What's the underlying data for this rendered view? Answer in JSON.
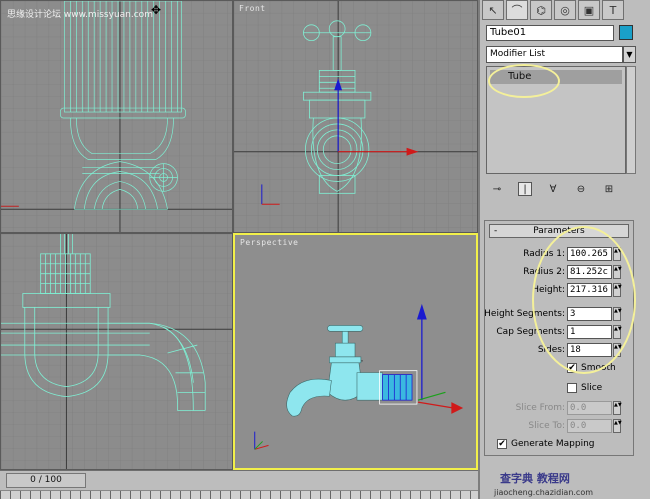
{
  "watermark": "思缘设计论坛 www.missyuan.com",
  "viewports": {
    "top_left": {
      "label": ""
    },
    "front": {
      "label": "Front"
    },
    "left": {
      "label": ""
    },
    "perspective": {
      "label": "Perspective"
    }
  },
  "timeline": {
    "frame": "0 / 100"
  },
  "command_panel": {
    "tabs": [
      {
        "icon": "create-icon",
        "glyph": "↖"
      },
      {
        "icon": "modify-icon",
        "glyph": "⌒"
      },
      {
        "icon": "hierarchy-icon",
        "glyph": "⌬"
      },
      {
        "icon": "motion-icon",
        "glyph": "◎"
      },
      {
        "icon": "display-icon",
        "glyph": "▣"
      },
      {
        "icon": "utilities-icon",
        "glyph": "T"
      }
    ],
    "object_name": "Tube01",
    "object_color": "#1aa0c8",
    "modifier_list": "Modifier List",
    "stack_items": [
      "Tube"
    ],
    "parameters": {
      "title": "Parameters",
      "collapse": "-",
      "radius1": {
        "label": "Radius 1:",
        "value": "100.265"
      },
      "radius2": {
        "label": "Radius 2:",
        "value": "81.252c"
      },
      "height": {
        "label": "Height:",
        "value": "217.316"
      },
      "height_segments": {
        "label": "Height Segments:",
        "value": "3"
      },
      "cap_segments": {
        "label": "Cap Segments:",
        "value": "1"
      },
      "sides": {
        "label": "Sides:",
        "value": "18"
      },
      "smooth": {
        "label": "Smooth",
        "checked": true
      },
      "slice": {
        "label": "Slice",
        "checked": false
      },
      "slice_from": {
        "label": "Slice From:",
        "value": "0.0"
      },
      "slice_to": {
        "label": "Slice To:",
        "value": "0.0"
      },
      "generate_mapping": {
        "label": "Generate Mapping",
        "checked": true
      }
    }
  },
  "footer_logo": "查字典 教程网",
  "footer_url": "jiaocheng.chazidian.com",
  "colors": {
    "wire": "#7ff0d4",
    "active_border": "#f2f04a",
    "annotation": "#f4f09a",
    "solid_object": "#8ee6ee"
  }
}
